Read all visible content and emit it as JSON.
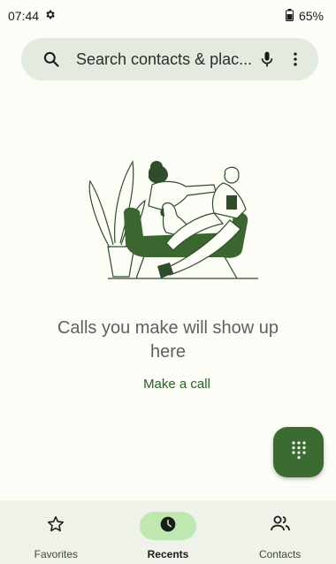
{
  "status_bar": {
    "time": "07:44",
    "battery": "65%",
    "settings_icon": "gear-icon",
    "battery_icon": "battery-icon"
  },
  "search": {
    "placeholder": "Search contacts & plac...",
    "icons": [
      "search-icon",
      "mic-icon",
      "more-vert-icon"
    ]
  },
  "empty_state": {
    "title": "Calls you make will show up here",
    "action": "Make a call"
  },
  "fab": {
    "icon": "dialpad-icon"
  },
  "bottom_nav": {
    "items": [
      {
        "label": "Favorites",
        "icon": "star-outline-icon",
        "active": false
      },
      {
        "label": "Recents",
        "icon": "clock-icon",
        "active": true
      },
      {
        "label": "Contacts",
        "icon": "people-icon",
        "active": false
      }
    ]
  },
  "colors": {
    "accent": "#3a6b31",
    "background": "#fbfdf6",
    "search_bg": "#e3eadf",
    "nav_bg": "#eef2e9",
    "active_pill": "#bfe8b0"
  }
}
